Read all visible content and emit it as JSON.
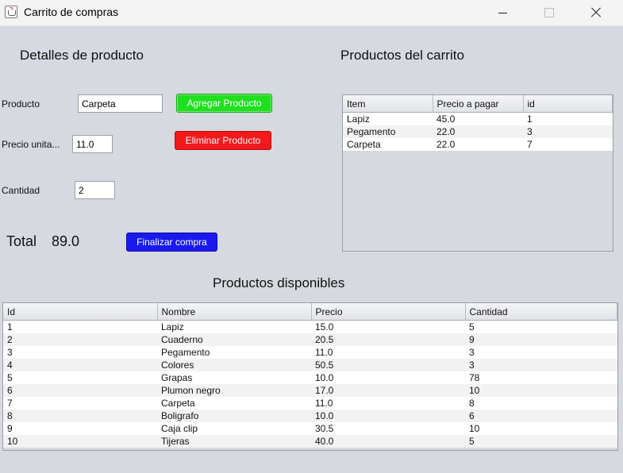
{
  "window": {
    "title": "Carrito de compras"
  },
  "details": {
    "heading": "Detalles de producto",
    "producto_label": "Producto",
    "producto_value": "Carpeta",
    "precio_label": "Precio unita...",
    "precio_value": "11.0",
    "cantidad_label": "Cantidad",
    "cantidad_value": "2",
    "add_button": "Agregar Producto",
    "remove_button": "Eliminar Producto",
    "total_label": "Total",
    "total_value": "89.0",
    "finalize_button": "Finalizar compra"
  },
  "cart": {
    "heading": "Productos del carrito",
    "columns": [
      "Item",
      "Precio a pagar",
      "id"
    ],
    "rows": [
      [
        "Lapiz",
        "45.0",
        "1"
      ],
      [
        "Pegamento",
        "22.0",
        "3"
      ],
      [
        "Carpeta",
        "22.0",
        "7"
      ]
    ]
  },
  "available": {
    "heading": "Productos disponibles",
    "columns": [
      "Id",
      "Nombre",
      "Precio",
      "Cantidad"
    ],
    "rows": [
      [
        "1",
        "Lapiz",
        "15.0",
        "5"
      ],
      [
        "2",
        "Cuaderno",
        "20.5",
        "9"
      ],
      [
        "3",
        "Pegamento",
        "11.0",
        "3"
      ],
      [
        "4",
        "Colores",
        "50.5",
        "3"
      ],
      [
        "5",
        "Grapas",
        "10.0",
        "78"
      ],
      [
        "6",
        "Plumon negro",
        "17.0",
        "10"
      ],
      [
        "7",
        "Carpeta",
        "11.0",
        "8"
      ],
      [
        "8",
        "Boligrafo",
        "10.0",
        "6"
      ],
      [
        "9",
        "Caja clip",
        "30.5",
        "10"
      ],
      [
        "10",
        "Tijeras",
        "40.0",
        "5"
      ]
    ]
  },
  "colors": {
    "background": "#d6d9df",
    "add_button": "#1ee01e",
    "remove_button": "#f2191b",
    "finalize_button": "#1a1aee"
  }
}
